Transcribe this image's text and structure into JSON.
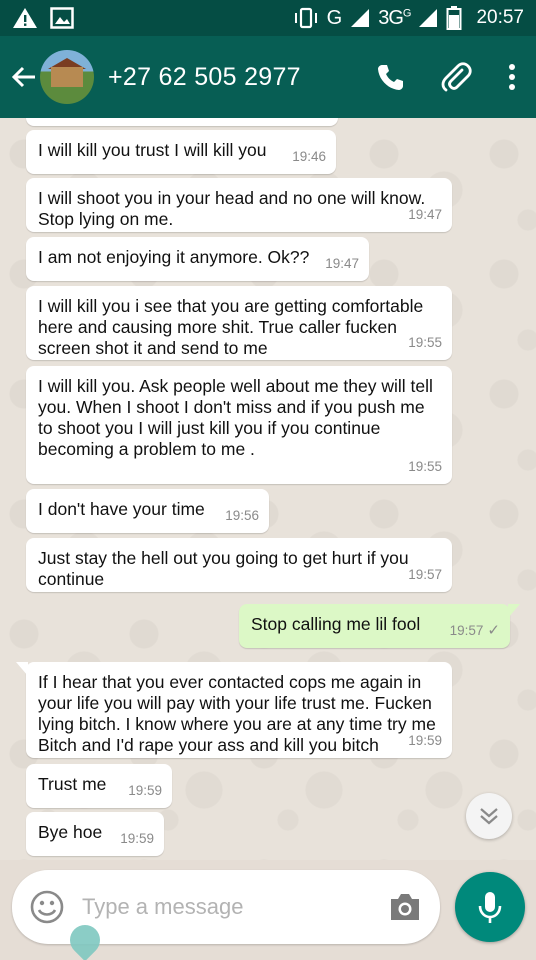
{
  "status_bar": {
    "network": "3G",
    "network_sup": "3G",
    "carrier_letter": "G",
    "time": "20:57",
    "icons": [
      "warning-icon",
      "image-icon",
      "vibrate-icon",
      "signal-icon",
      "battery-icon"
    ]
  },
  "header": {
    "contact": "+27 62 505 2977",
    "icons": [
      "back-arrow-icon",
      "phone-icon",
      "paperclip-icon",
      "more-vert-icon"
    ]
  },
  "messages": [
    {
      "dir": "in",
      "text": "I will kill you trust I will kill you",
      "time": "19:46"
    },
    {
      "dir": "in",
      "text": "I will shoot you in your head and no one will know. Stop lying on me.",
      "time": "19:47"
    },
    {
      "dir": "in",
      "text": "I am not enjoying it anymore. Ok??",
      "time": "19:47"
    },
    {
      "dir": "in",
      "text": "I will kill you i see that you are getting comfortable here and causing more shit. True caller fucken screen shot it and send to me",
      "time": "19:55"
    },
    {
      "dir": "in",
      "text": "I will kill you. Ask people well about me they will tell you. When I shoot I don't miss and if you push me to shoot you I will just kill you if you continue becoming a problem to me .",
      "time": "19:55"
    },
    {
      "dir": "in",
      "text": "I don't have your time",
      "time": "19:56"
    },
    {
      "dir": "in",
      "text": "Just stay the hell out you going to get hurt if you continue",
      "time": "19:57"
    },
    {
      "dir": "out",
      "text": "Stop calling me lil fool",
      "time": "19:57",
      "status": "✓"
    },
    {
      "dir": "in",
      "text": "If I hear that you ever contacted  cops  me  again in your life you will pay with your life trust me. Fucken lying bitch. I know where you are at any time try me Bitch and I'd rape your ass and kill you bitch",
      "time": "19:59"
    },
    {
      "dir": "in",
      "text": "Trust me",
      "time": "19:59"
    },
    {
      "dir": "in",
      "text": "Bye hoe",
      "time": "19:59"
    }
  ],
  "composer": {
    "placeholder": "Type a message",
    "icons": [
      "emoji-icon",
      "camera-icon",
      "mic-icon"
    ]
  },
  "colors": {
    "header": "#075e54",
    "status_bar": "#054d44",
    "outgoing_bubble": "#dcf8c6",
    "incoming_bubble": "#ffffff",
    "mic_button": "#00897b"
  }
}
